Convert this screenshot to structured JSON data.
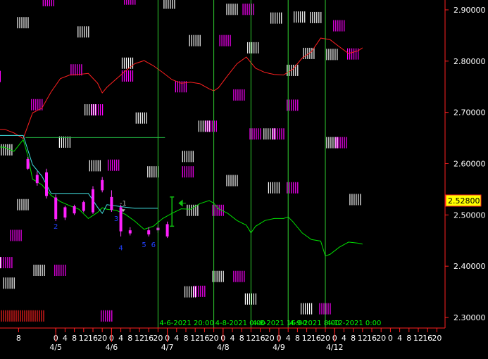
{
  "chart_data": {
    "type": "line",
    "y_axis": {
      "ylim": [
        2.285,
        2.925
      ],
      "ticks": [
        2.3,
        2.4,
        2.5,
        2.6,
        2.7,
        2.8,
        2.9
      ],
      "tick_labels": [
        "2.30000",
        "2.40000",
        "2.50000",
        "2.60000",
        "2.70000",
        "2.80000",
        "2.90000"
      ]
    },
    "x_axis": {
      "hour_labels": [
        {
          "hour": 8,
          "t": 8
        },
        {
          "hour": 0,
          "t": 24
        },
        {
          "hour": 4,
          "t": 28
        },
        {
          "hour": 8,
          "t": 32
        },
        {
          "hour": 12,
          "t": 36
        },
        {
          "hour": 16,
          "t": 40
        },
        {
          "hour": 20,
          "t": 44
        },
        {
          "hour": 0,
          "t": 48
        },
        {
          "hour": 4,
          "t": 52
        },
        {
          "hour": 8,
          "t": 56
        },
        {
          "hour": 12,
          "t": 60
        },
        {
          "hour": 16,
          "t": 64
        },
        {
          "hour": 20,
          "t": 68
        },
        {
          "hour": 0,
          "t": 72
        },
        {
          "hour": 4,
          "t": 76
        },
        {
          "hour": 8,
          "t": 80
        },
        {
          "hour": 12,
          "t": 84
        },
        {
          "hour": 16,
          "t": 88
        },
        {
          "hour": 20,
          "t": 92
        },
        {
          "hour": 0,
          "t": 96
        },
        {
          "hour": 4,
          "t": 100
        },
        {
          "hour": 8,
          "t": 104
        },
        {
          "hour": 12,
          "t": 108
        },
        {
          "hour": 16,
          "t": 112
        },
        {
          "hour": 20,
          "t": 116
        },
        {
          "hour": 0,
          "t": 120
        },
        {
          "hour": 4,
          "t": 124
        },
        {
          "hour": 8,
          "t": 128
        },
        {
          "hour": 12,
          "t": 132
        },
        {
          "hour": 16,
          "t": 136
        },
        {
          "hour": 20,
          "t": 140
        },
        {
          "hour": 0,
          "t": 144
        },
        {
          "hour": 4,
          "t": 148
        },
        {
          "hour": 8,
          "t": 152
        },
        {
          "hour": 12,
          "t": 156
        },
        {
          "hour": 16,
          "t": 160
        },
        {
          "hour": 20,
          "t": 164
        },
        {
          "hour": 0,
          "t": 168
        },
        {
          "hour": 4,
          "t": 172
        },
        {
          "hour": 8,
          "t": 176
        },
        {
          "hour": 12,
          "t": 180
        },
        {
          "hour": 16,
          "t": 184
        },
        {
          "hour": 20,
          "t": 188
        },
        {
          "hour": 0,
          "t": 192
        },
        {
          "hour": 4,
          "t": 196
        },
        {
          "hour": 8,
          "t": 200
        },
        {
          "hour": 12,
          "t": 204
        }
      ],
      "hour_label_texts": [
        "8",
        "0",
        "4",
        "8",
        "12",
        "16",
        "20",
        "0",
        "4",
        "8",
        "12",
        "16",
        "20",
        "0",
        "4",
        "8",
        "12",
        "16",
        "20",
        "0",
        "4",
        "8",
        "12",
        "16",
        "20",
        "0",
        "4",
        "8",
        "12",
        "16",
        "20",
        "0",
        "4",
        "8",
        "12",
        "16",
        "20",
        "0",
        "4",
        "8",
        "12",
        "16",
        "20",
        "0",
        "4",
        "8",
        "12"
      ],
      "date_labels": [
        {
          "text": "4/5",
          "t": 24
        },
        {
          "text": "4/6",
          "t": 48
        },
        {
          "text": "4/7",
          "t": 72
        },
        {
          "text": "4/8",
          "t": 96
        },
        {
          "text": "4/9",
          "t": 120
        },
        {
          "text": "4/12",
          "t": 144
        }
      ]
    },
    "vertical_lines": [
      {
        "t": 68,
        "label": "4-6-2021 20:00"
      },
      {
        "t": 92,
        "label": "4-8-2021 0:00"
      },
      {
        "t": 108,
        "label": "4-8-2021 16:00"
      },
      {
        "t": 124,
        "label": "4-9-2021 8:00"
      },
      {
        "t": 140,
        "label": "4-12-2021 0:00"
      }
    ],
    "current_price": {
      "value": 2.528,
      "label": "2.52800"
    },
    "series": [
      {
        "color": "#ff2020",
        "points": [
          [
            -2,
            2.667
          ],
          [
            2,
            2.667
          ],
          [
            6,
            2.66
          ],
          [
            10,
            2.649
          ],
          [
            14,
            2.699
          ],
          [
            18,
            2.708
          ],
          [
            22,
            2.74
          ],
          [
            26,
            2.766
          ],
          [
            30,
            2.773
          ],
          [
            34,
            2.774
          ],
          [
            38,
            2.776
          ],
          [
            42,
            2.757
          ],
          [
            44,
            2.738
          ],
          [
            46,
            2.749
          ],
          [
            50,
            2.765
          ],
          [
            54,
            2.781
          ],
          [
            58,
            2.795
          ],
          [
            62,
            2.801
          ],
          [
            66,
            2.791
          ],
          [
            70,
            2.778
          ],
          [
            74,
            2.764
          ],
          [
            78,
            2.757
          ],
          [
            82,
            2.759
          ],
          [
            86,
            2.756
          ],
          [
            90,
            2.746
          ],
          [
            92,
            2.742
          ],
          [
            94,
            2.748
          ],
          [
            98,
            2.772
          ],
          [
            102,
            2.795
          ],
          [
            106,
            2.808
          ],
          [
            110,
            2.786
          ],
          [
            114,
            2.778
          ],
          [
            118,
            2.774
          ],
          [
            122,
            2.773
          ],
          [
            126,
            2.784
          ],
          [
            130,
            2.806
          ],
          [
            134,
            2.818
          ],
          [
            138,
            2.845
          ],
          [
            142,
            2.842
          ],
          [
            146,
            2.828
          ],
          [
            150,
            2.815
          ],
          [
            154,
            2.82
          ],
          [
            156,
            2.826
          ]
        ]
      },
      {
        "color": "#00e000",
        "points": [
          [
            -2,
            2.633
          ],
          [
            2,
            2.632
          ],
          [
            6,
            2.624
          ],
          [
            10,
            2.647
          ],
          [
            12,
            2.615
          ],
          [
            14,
            2.57
          ],
          [
            18,
            2.559
          ],
          [
            22,
            2.538
          ],
          [
            26,
            2.526
          ],
          [
            30,
            2.518
          ],
          [
            34,
            2.511
          ],
          [
            38,
            2.493
          ],
          [
            42,
            2.505
          ],
          [
            44,
            2.514
          ],
          [
            46,
            2.511
          ],
          [
            50,
            2.509
          ],
          [
            54,
            2.501
          ],
          [
            58,
            2.488
          ],
          [
            62,
            2.472
          ],
          [
            66,
            2.478
          ],
          [
            70,
            2.493
          ],
          [
            74,
            2.503
          ],
          [
            78,
            2.512
          ],
          [
            82,
            2.511
          ],
          [
            86,
            2.522
          ],
          [
            90,
            2.528
          ],
          [
            92,
            2.523
          ],
          [
            94,
            2.512
          ],
          [
            98,
            2.503
          ],
          [
            102,
            2.489
          ],
          [
            106,
            2.48
          ],
          [
            108,
            2.465
          ],
          [
            110,
            2.478
          ],
          [
            114,
            2.489
          ],
          [
            118,
            2.493
          ],
          [
            122,
            2.493
          ],
          [
            124,
            2.496
          ],
          [
            126,
            2.487
          ],
          [
            130,
            2.465
          ],
          [
            134,
            2.452
          ],
          [
            138,
            2.449
          ],
          [
            140,
            2.42
          ],
          [
            142,
            2.423
          ],
          [
            146,
            2.437
          ],
          [
            150,
            2.447
          ],
          [
            154,
            2.445
          ],
          [
            156,
            2.443
          ]
        ]
      },
      {
        "color": "#40e0e0",
        "points": [
          [
            -2,
            2.655
          ],
          [
            10,
            2.655
          ],
          [
            14,
            2.598
          ],
          [
            18,
            2.576
          ],
          [
            22,
            2.542
          ],
          [
            30,
            2.542
          ],
          [
            38,
            2.542
          ],
          [
            42,
            2.515
          ],
          [
            44,
            2.503
          ],
          [
            46,
            2.52
          ],
          [
            54,
            2.515
          ],
          [
            58,
            2.513
          ],
          [
            66,
            2.513
          ],
          [
            68,
            2.513
          ]
        ]
      }
    ],
    "horizontal_segments": [
      {
        "t0": 11,
        "t1": 71,
        "value": 2.651,
        "color": "#20b040"
      }
    ],
    "candles": [
      {
        "t": 12,
        "open": 2.609,
        "close": 2.59,
        "high": 2.613,
        "low": 2.588
      },
      {
        "t": 16,
        "open": 2.578,
        "close": 2.562,
        "high": 2.585,
        "low": 2.557
      },
      {
        "t": 20,
        "open": 2.583,
        "close": 2.537,
        "high": 2.59,
        "low": 2.532
      },
      {
        "t": 24,
        "open": 2.534,
        "close": 2.492,
        "high": 2.54,
        "low": 2.488
      },
      {
        "t": 28,
        "open": 2.515,
        "close": 2.495,
        "high": 2.518,
        "low": 2.49
      },
      {
        "t": 32,
        "open": 2.517,
        "close": 2.503,
        "high": 2.52,
        "low": 2.5
      },
      {
        "t": 36,
        "open": 2.525,
        "close": 2.508,
        "high": 2.528,
        "low": 2.505
      },
      {
        "t": 40,
        "open": 2.55,
        "close": 2.505,
        "high": 2.556,
        "low": 2.502
      },
      {
        "t": 44,
        "open": 2.568,
        "close": 2.548,
        "high": 2.574,
        "low": 2.544
      },
      {
        "t": 48,
        "open": 2.535,
        "close": 2.51,
        "high": 2.548,
        "low": 2.506
      },
      {
        "t": 52,
        "open": 2.515,
        "close": 2.468,
        "high": 2.52,
        "low": 2.458
      },
      {
        "t": 56,
        "open": 2.47,
        "close": 2.464,
        "high": 2.476,
        "low": 2.46
      },
      {
        "t": 64,
        "open": 2.47,
        "close": 2.462,
        "high": 2.476,
        "low": 2.458
      },
      {
        "t": 68,
        "open": 2.475,
        "close": 2.47,
        "high": 2.48,
        "low": 2.465
      },
      {
        "t": 72,
        "open": 2.482,
        "close": 2.458,
        "high": 2.487,
        "low": 2.455
      }
    ],
    "wave_labels": [
      {
        "text": "-1",
        "t": 53,
        "value": 2.518,
        "color": "#b0b0b0"
      },
      {
        "text": "2",
        "t": 24,
        "value": 2.473,
        "color": "#2040ff"
      },
      {
        "text": "3",
        "t": 50,
        "value": 2.488,
        "color": "#2040ff"
      },
      {
        "text": "4",
        "t": 52,
        "value": 2.431,
        "color": "#2040ff"
      },
      {
        "text": "5",
        "t": 62,
        "value": 2.437,
        "color": "#2040ff"
      },
      {
        "text": "6",
        "t": 66,
        "value": 2.437,
        "color": "#2040ff"
      }
    ],
    "vertical_marker": {
      "t": 74,
      "top": 2.535,
      "bottom": 2.478,
      "color": "#10c010"
    },
    "arrow_marker": {
      "t": 77,
      "value": 2.523,
      "color": "#10c010"
    },
    "decorative_tick_blocks": [
      {
        "t": 21,
        "value": 2.918,
        "color": "#ff00ff"
      },
      {
        "t": 56,
        "value": 2.921,
        "color": "#ff00ff"
      },
      {
        "t": 73,
        "value": 2.913,
        "color": "#ffffff"
      },
      {
        "t": 100,
        "value": 2.901,
        "color": "#ffffff"
      },
      {
        "t": 107,
        "value": 2.901,
        "color": "#ff00ff"
      },
      {
        "t": 119,
        "value": 2.884,
        "color": "#ffffff"
      },
      {
        "t": 129,
        "value": 2.886,
        "color": "#ffffff"
      },
      {
        "t": 136,
        "value": 2.885,
        "color": "#ffffff"
      },
      {
        "t": 146,
        "value": 2.869,
        "color": "#ff00ff"
      },
      {
        "t": 10,
        "value": 2.875,
        "color": "#ffffff"
      },
      {
        "t": 36,
        "value": 2.857,
        "color": "#ffffff"
      },
      {
        "t": 84,
        "value": 2.84,
        "color": "#ffffff"
      },
      {
        "t": 97,
        "value": 2.84,
        "color": "#ff00ff"
      },
      {
        "t": 109,
        "value": 2.826,
        "color": "#ffffff"
      },
      {
        "t": 133,
        "value": 2.815,
        "color": "#ffffff"
      },
      {
        "t": 143,
        "value": 2.813,
        "color": "#ffffff"
      },
      {
        "t": 152,
        "value": 2.814,
        "color": "#ff00ff"
      },
      {
        "t": 55,
        "value": 2.796,
        "color": "#ffffff"
      },
      {
        "t": 126,
        "value": 2.782,
        "color": "#ffffff"
      },
      {
        "t": 33,
        "value": 2.783,
        "color": "#ff00ff"
      },
      {
        "t": 55,
        "value": 2.771,
        "color": "#ff00ff"
      },
      {
        "t": -2,
        "value": 2.77,
        "color": "#ff00ff"
      },
      {
        "t": 78,
        "value": 2.75,
        "color": "#ff00ff"
      },
      {
        "t": 103,
        "value": 2.734,
        "color": "#ff00ff"
      },
      {
        "t": 16,
        "value": 2.715,
        "color": "#ff00ff"
      },
      {
        "t": 126,
        "value": 2.714,
        "color": "#ff00ff"
      },
      {
        "t": 39,
        "value": 2.705,
        "color": "#ffffff"
      },
      {
        "t": 42,
        "value": 2.705,
        "color": "#ff00ff"
      },
      {
        "t": 61,
        "value": 2.689,
        "color": "#ffffff"
      },
      {
        "t": 88,
        "value": 2.673,
        "color": "#ffffff"
      },
      {
        "t": 91,
        "value": 2.673,
        "color": "#ff00ff"
      },
      {
        "t": 110,
        "value": 2.658,
        "color": "#ff00ff"
      },
      {
        "t": 116,
        "value": 2.658,
        "color": "#ffffff"
      },
      {
        "t": 120,
        "value": 2.658,
        "color": "#ff00ff"
      },
      {
        "t": 28,
        "value": 2.642,
        "color": "#ffffff"
      },
      {
        "t": 143,
        "value": 2.641,
        "color": "#ffffff"
      },
      {
        "t": 147,
        "value": 2.641,
        "color": "#ff00ff"
      },
      {
        "t": 3,
        "value": 2.627,
        "color": "#ffffff"
      },
      {
        "t": 81,
        "value": 2.614,
        "color": "#ffffff"
      },
      {
        "t": 41,
        "value": 2.596,
        "color": "#ffffff"
      },
      {
        "t": 49,
        "value": 2.597,
        "color": "#ff00ff"
      },
      {
        "t": 66,
        "value": 2.584,
        "color": "#ffffff"
      },
      {
        "t": 81,
        "value": 2.584,
        "color": "#ff00ff"
      },
      {
        "t": 100,
        "value": 2.567,
        "color": "#ffffff"
      },
      {
        "t": 118,
        "value": 2.553,
        "color": "#ffffff"
      },
      {
        "t": 126,
        "value": 2.553,
        "color": "#ff00ff"
      },
      {
        "t": 153,
        "value": 2.53,
        "color": "#ffffff"
      },
      {
        "t": 10,
        "value": 2.52,
        "color": "#ffffff"
      },
      {
        "t": 83,
        "value": 2.509,
        "color": "#ffffff"
      },
      {
        "t": 94,
        "value": 2.509,
        "color": "#ff00ff"
      },
      {
        "t": 7,
        "value": 2.46,
        "color": "#ff00ff"
      },
      {
        "t": -2,
        "value": 2.407,
        "color": "#ffffff"
      },
      {
        "t": 3,
        "value": 2.407,
        "color": "#ff00ff"
      },
      {
        "t": 17,
        "value": 2.392,
        "color": "#ffffff"
      },
      {
        "t": 26,
        "value": 2.392,
        "color": "#ff00ff"
      },
      {
        "t": 94,
        "value": 2.38,
        "color": "#ffffff"
      },
      {
        "t": 103,
        "value": 2.38,
        "color": "#ff00ff"
      },
      {
        "t": 4,
        "value": 2.367,
        "color": "#ffffff"
      },
      {
        "t": 82,
        "value": 2.35,
        "color": "#ffffff"
      },
      {
        "t": 86,
        "value": 2.351,
        "color": "#ff00ff"
      },
      {
        "t": 108,
        "value": 2.336,
        "color": "#ffffff"
      },
      {
        "t": 132,
        "value": 2.317,
        "color": "#ffffff"
      },
      {
        "t": 140,
        "value": 2.317,
        "color": "#ff00ff"
      },
      {
        "t": 46,
        "value": 2.303,
        "color": "#ff00ff"
      }
    ],
    "volume_strip": {
      "t0": -2,
      "t1": 10,
      "value": 2.303,
      "color": "#ff2020"
    }
  }
}
